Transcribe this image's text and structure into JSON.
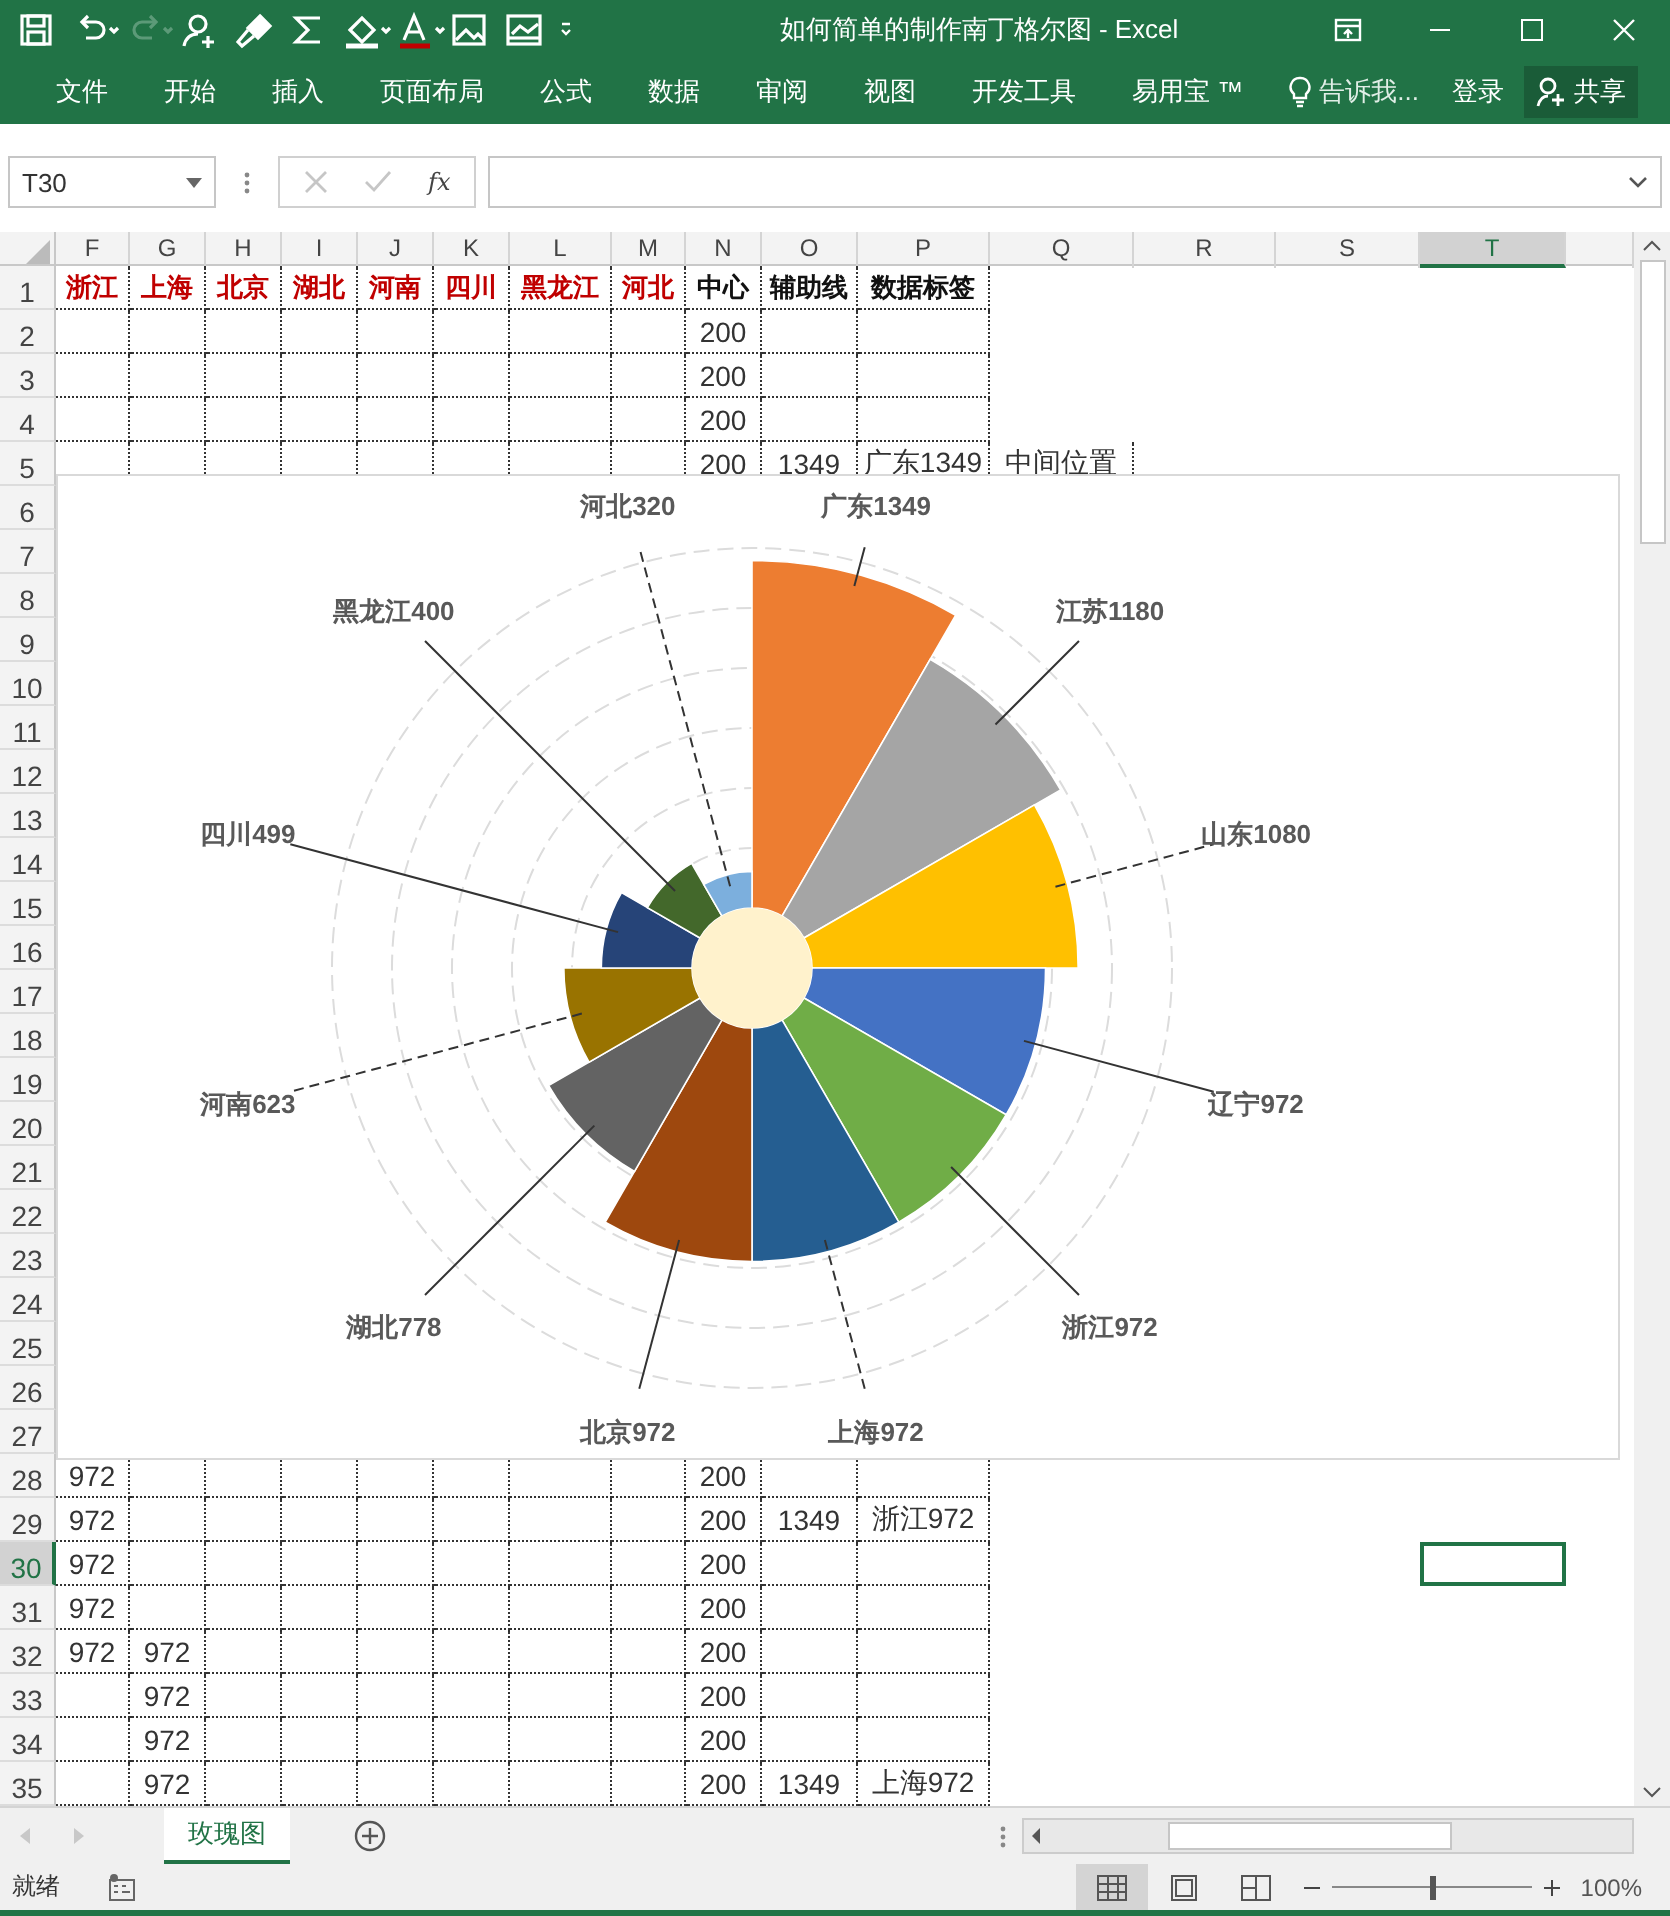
{
  "window": {
    "title": "如何简单的制作南丁格尔图 - Excel"
  },
  "quick_access": [
    {
      "kind": "save",
      "disabled": false
    },
    {
      "kind": "undo",
      "disabled": false
    },
    {
      "kind": "redo",
      "disabled": true
    },
    {
      "kind": "person",
      "disabled": false
    },
    {
      "kind": "brush",
      "disabled": false
    },
    {
      "kind": "sigma",
      "disabled": false
    },
    {
      "kind": "fill",
      "disabled": false
    },
    {
      "kind": "font_color",
      "disabled": false
    },
    {
      "kind": "picture",
      "disabled": false
    },
    {
      "kind": "chart",
      "disabled": false
    },
    {
      "kind": "more",
      "disabled": false
    }
  ],
  "ribbon": {
    "tabs": [
      {
        "label": "文件",
        "selected": false
      },
      {
        "label": "开始",
        "selected": false
      },
      {
        "label": "插入",
        "selected": false
      },
      {
        "label": "页面布局",
        "selected": false
      },
      {
        "label": "公式",
        "selected": false
      },
      {
        "label": "数据",
        "selected": false
      },
      {
        "label": "审阅",
        "selected": false
      },
      {
        "label": "视图",
        "selected": false
      },
      {
        "label": "开发工具",
        "selected": false
      },
      {
        "label": "易用宝 ™",
        "selected": false
      }
    ],
    "tell_me": "告诉我...",
    "sign_in": "登录",
    "share": "共享"
  },
  "formula_bar": {
    "name_box": "T30",
    "cancel_disabled": true,
    "enter_disabled": true,
    "fx": "fx"
  },
  "sheet": {
    "columns": [
      {
        "label": "F",
        "selected": false
      },
      {
        "label": "G",
        "selected": false
      },
      {
        "label": "H",
        "selected": false
      },
      {
        "label": "I",
        "selected": false
      },
      {
        "label": "J",
        "selected": false
      },
      {
        "label": "K",
        "selected": false
      },
      {
        "label": "L",
        "selected": false
      },
      {
        "label": "M",
        "selected": false
      },
      {
        "label": "N",
        "selected": false
      },
      {
        "label": "O",
        "selected": false
      },
      {
        "label": "P",
        "selected": false
      },
      {
        "label": "Q",
        "selected": false
      },
      {
        "label": "R",
        "selected": false
      },
      {
        "label": "S",
        "selected": false
      },
      {
        "label": "T",
        "selected": true
      }
    ],
    "rows": [
      {
        "header": "1",
        "selected": false,
        "cells": [
          {
            "text": "浙江",
            "kind": "category"
          },
          {
            "text": "上海",
            "kind": "category"
          },
          {
            "text": "北京",
            "kind": "category"
          },
          {
            "text": "湖北",
            "kind": "category"
          },
          {
            "text": "河南",
            "kind": "category"
          },
          {
            "text": "四川",
            "kind": "category"
          },
          {
            "text": "黑龙江",
            "kind": "category"
          },
          {
            "text": "河北",
            "kind": "category"
          },
          {
            "text": "中心",
            "kind": "field"
          },
          {
            "text": "辅助线",
            "kind": "field"
          },
          {
            "text": "数据标签",
            "kind": "field"
          }
        ]
      },
      {
        "header": "2",
        "selected": false,
        "cells": [
          null,
          null,
          null,
          null,
          null,
          null,
          null,
          null,
          {
            "text": "200",
            "kind": "value"
          }
        ]
      },
      {
        "header": "3",
        "selected": false,
        "cells": [
          null,
          null,
          null,
          null,
          null,
          null,
          null,
          null,
          {
            "text": "200",
            "kind": "value"
          }
        ]
      },
      {
        "header": "4",
        "selected": false,
        "cells": [
          null,
          null,
          null,
          null,
          null,
          null,
          null,
          null,
          {
            "text": "200",
            "kind": "value"
          }
        ]
      },
      {
        "header": "5",
        "selected": false,
        "cells": [
          null,
          null,
          null,
          null,
          null,
          null,
          null,
          null,
          {
            "text": "200",
            "kind": "value"
          },
          {
            "text": "1349",
            "kind": "value"
          },
          {
            "text": "广东1349",
            "kind": "value"
          },
          {
            "text": "中间位置",
            "kind": "value"
          }
        ]
      },
      {
        "header": "6",
        "selected": false
      },
      {
        "header": "7",
        "selected": false
      },
      {
        "header": "8",
        "selected": false
      },
      {
        "header": "9",
        "selected": false
      },
      {
        "header": "10",
        "selected": false
      },
      {
        "header": "11",
        "selected": false
      },
      {
        "header": "12",
        "selected": false
      },
      {
        "header": "13",
        "selected": false
      },
      {
        "header": "14",
        "selected": false
      },
      {
        "header": "15",
        "selected": false
      },
      {
        "header": "16",
        "selected": false
      },
      {
        "header": "17",
        "selected": false
      },
      {
        "header": "18",
        "selected": false
      },
      {
        "header": "19",
        "selected": false
      },
      {
        "header": "20",
        "selected": false
      },
      {
        "header": "21",
        "selected": false
      },
      {
        "header": "22",
        "selected": false
      },
      {
        "header": "23",
        "selected": false
      },
      {
        "header": "24",
        "selected": false
      },
      {
        "header": "25",
        "selected": false
      },
      {
        "header": "26",
        "selected": false
      },
      {
        "header": "27",
        "selected": false
      },
      {
        "header": "28",
        "selected": false,
        "cells": [
          {
            "text": "972",
            "kind": "value"
          },
          null,
          null,
          null,
          null,
          null,
          null,
          null,
          {
            "text": "200",
            "kind": "value"
          }
        ]
      },
      {
        "header": "29",
        "selected": false,
        "cells": [
          {
            "text": "972",
            "kind": "value"
          },
          null,
          null,
          null,
          null,
          null,
          null,
          null,
          {
            "text": "200",
            "kind": "value"
          },
          {
            "text": "1349",
            "kind": "value"
          },
          {
            "text": "浙江972",
            "kind": "value"
          }
        ]
      },
      {
        "header": "30",
        "selected": true,
        "cells": [
          {
            "text": "972",
            "kind": "value"
          },
          null,
          null,
          null,
          null,
          null,
          null,
          null,
          {
            "text": "200",
            "kind": "value"
          }
        ]
      },
      {
        "header": "31",
        "selected": false,
        "cells": [
          {
            "text": "972",
            "kind": "value"
          },
          null,
          null,
          null,
          null,
          null,
          null,
          null,
          {
            "text": "200",
            "kind": "value"
          }
        ]
      },
      {
        "header": "32",
        "selected": false,
        "cells": [
          {
            "text": "972",
            "kind": "value"
          },
          {
            "text": "972",
            "kind": "value"
          },
          null,
          null,
          null,
          null,
          null,
          null,
          {
            "text": "200",
            "kind": "value"
          }
        ]
      },
      {
        "header": "33",
        "selected": false,
        "cells": [
          null,
          {
            "text": "972",
            "kind": "value"
          },
          null,
          null,
          null,
          null,
          null,
          null,
          {
            "text": "200",
            "kind": "value"
          }
        ]
      },
      {
        "header": "34",
        "selected": false,
        "cells": [
          null,
          {
            "text": "972",
            "kind": "value"
          },
          null,
          null,
          null,
          null,
          null,
          null,
          {
            "text": "200",
            "kind": "value"
          }
        ]
      },
      {
        "header": "35",
        "selected": false,
        "cells": [
          null,
          {
            "text": "972",
            "kind": "value"
          },
          null,
          null,
          null,
          null,
          null,
          null,
          {
            "text": "200",
            "kind": "value"
          },
          {
            "text": "1349",
            "kind": "value"
          },
          {
            "text": "上海972",
            "kind": "value"
          }
        ]
      }
    ]
  },
  "rose_chart": {
    "segments": [
      {
        "label": "广东1349",
        "color": "#ed7d31"
      },
      {
        "label": "江苏1180",
        "color": "#a5a5a5"
      },
      {
        "label": "山东1080",
        "color": "#ffc000"
      },
      {
        "label": "辽宁972",
        "color": "#4472c4"
      },
      {
        "label": "浙江972",
        "color": "#70ad47"
      },
      {
        "label": "上海972",
        "color": "#255e91"
      },
      {
        "label": "北京972",
        "color": "#9e480e"
      },
      {
        "label": "湖北778",
        "color": "#636363"
      },
      {
        "label": "河南623",
        "color": "#997300"
      },
      {
        "label": "四川499",
        "color": "#264478"
      },
      {
        "label": "黑龙江400",
        "color": "#43682b"
      },
      {
        "label": "河北320",
        "color": "#7cafdd"
      }
    ]
  },
  "sheet_tabs": [
    {
      "label": "玫瑰图",
      "selected": true
    }
  ],
  "status_bar": {
    "status": "就绪",
    "views": [
      {
        "kind": "normal",
        "selected": true
      },
      {
        "kind": "page_layout",
        "selected": false
      },
      {
        "kind": "page_break",
        "selected": false
      }
    ],
    "zoom": {
      "level": 0.5,
      "reading": "100%"
    }
  }
}
